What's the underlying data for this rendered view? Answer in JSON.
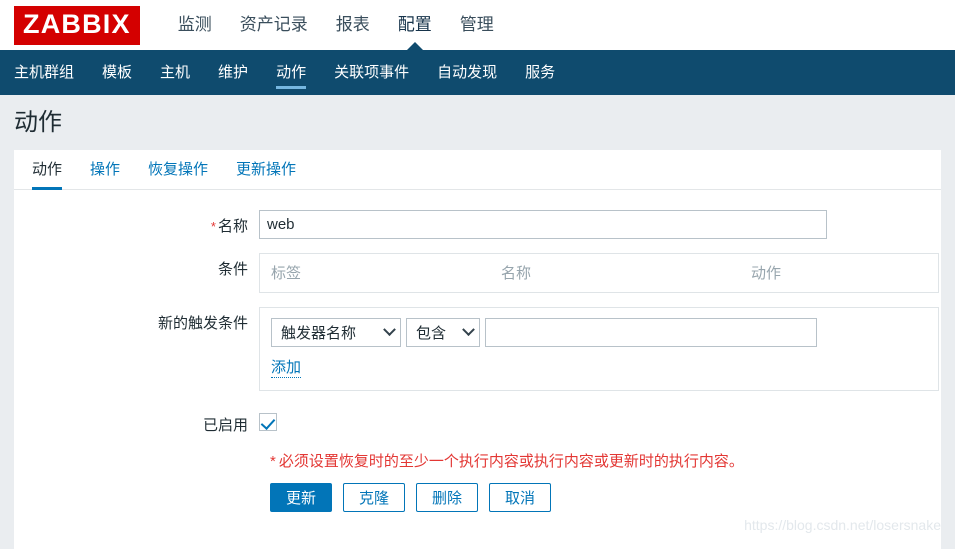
{
  "header": {
    "logo_text": "ZABBIX",
    "menu": [
      {
        "label": "监测",
        "active": false
      },
      {
        "label": "资产记录",
        "active": false
      },
      {
        "label": "报表",
        "active": false
      },
      {
        "label": "配置",
        "active": true
      },
      {
        "label": "管理",
        "active": false
      }
    ]
  },
  "subnav": {
    "items": [
      {
        "label": "主机群组",
        "active": false
      },
      {
        "label": "模板",
        "active": false
      },
      {
        "label": "主机",
        "active": false
      },
      {
        "label": "维护",
        "active": false
      },
      {
        "label": "动作",
        "active": true
      },
      {
        "label": "关联项事件",
        "active": false
      },
      {
        "label": "自动发现",
        "active": false
      },
      {
        "label": "服务",
        "active": false
      }
    ]
  },
  "page": {
    "title": "动作"
  },
  "tabs": [
    {
      "label": "动作",
      "active": true
    },
    {
      "label": "操作",
      "active": false
    },
    {
      "label": "恢复操作",
      "active": false
    },
    {
      "label": "更新操作",
      "active": false
    }
  ],
  "form": {
    "name": {
      "label": "名称",
      "required_marker": "*",
      "value": "web",
      "placeholder": ""
    },
    "conditions": {
      "label": "条件",
      "columns": [
        "标签",
        "名称",
        "动作"
      ],
      "rows": []
    },
    "new_condition": {
      "label": "新的触发条件",
      "type_select": {
        "value": "触发器名称",
        "options": [
          "触发器名称"
        ]
      },
      "operator_select": {
        "value": "包含",
        "options": [
          "包含"
        ]
      },
      "value_input": {
        "value": "",
        "placeholder": ""
      },
      "add_link": "添加"
    },
    "enabled": {
      "label": "已启用",
      "checked": true
    },
    "warning": {
      "star": "*",
      "text": "必须设置恢复时的至少一个执行内容或执行内容或更新时的执行内容。"
    },
    "buttons": [
      {
        "label": "更新",
        "style": "primary"
      },
      {
        "label": "克隆",
        "style": "secondary"
      },
      {
        "label": "删除",
        "style": "secondary"
      },
      {
        "label": "取消",
        "style": "secondary"
      }
    ]
  },
  "watermark": "https://blog.csdn.net/losersnake",
  "colors": {
    "brand_red": "#d40000",
    "nav_blue": "#0f4b6e",
    "accent_blue": "#0275b8",
    "active_underline": "#76b7e0",
    "error_red": "#e33734",
    "page_bg": "#eaedf0"
  }
}
